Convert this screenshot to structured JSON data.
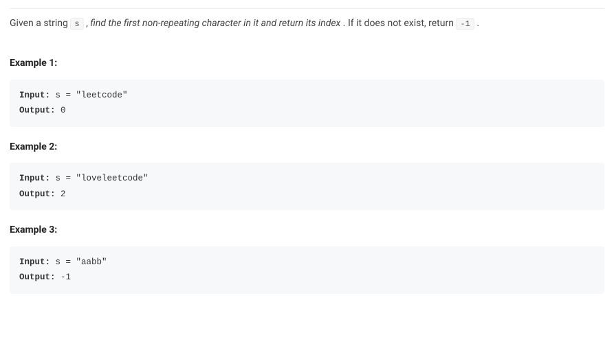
{
  "statement": {
    "prefix": "Given a string ",
    "var": "s",
    "middle": ", ",
    "emphasis": "find the first non-repeating character in it and return its index",
    "after": ". If it does not exist, return ",
    "retval": "-1",
    "suffix": "."
  },
  "examples": [
    {
      "heading": "Example 1:",
      "inputLabel": "Input:",
      "inputText": " s = \"leetcode\"",
      "outputLabel": "Output:",
      "outputText": " 0"
    },
    {
      "heading": "Example 2:",
      "inputLabel": "Input:",
      "inputText": " s = \"loveleetcode\"",
      "outputLabel": "Output:",
      "outputText": " 2"
    },
    {
      "heading": "Example 3:",
      "inputLabel": "Input:",
      "inputText": " s = \"aabb\"",
      "outputLabel": "Output:",
      "outputText": " -1"
    }
  ]
}
